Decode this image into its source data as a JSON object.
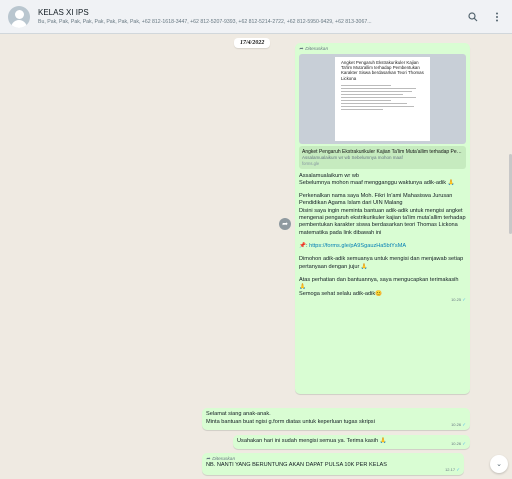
{
  "header": {
    "title": "KELAS XI IPS",
    "subtitle": "Bu, Pak, Pak, Pak, Pak, Pak, Pak, Pak, Pak, +62 812-1618-3447, +62 812-5207-9393, +62 812-5214-2722, +62 812-5950-9429, +62 813-3067..."
  },
  "chat": {
    "date": "17/4/2022",
    "forwarded_label": "Diteruskan",
    "doc": {
      "title": "Angket Pengaruh Ekstrakurikuler Kajian Ta'lim Muta'allim terhadap Pembentukan Karakter Siswa berdasarkan Teori Thomas Lickona"
    },
    "link": {
      "title": "Angket Pengaruh Ekstrakurikuler Kajian Ta'lim Muta'allim terhadap Pembentukan Karakter Siswa...",
      "desc": "Assalamualaikum wr wb Sebelumnya mohon maaf",
      "domain": "forms.gle"
    },
    "main_msg": {
      "p1": "Assalamualaikum wr wb\nSebelumnya mohon maaf mengganggu waktunya adik-adik 🙏",
      "p2": "Perkenalkan nama saya Moh. Fikri In'ami Mahasiswa Jurusan Pendidikan Agama Islam dari UIN Malang\nDisini saya ingin meminta bantuan adik-adik untuk mengisi angket mengenai pengaruh ekstrikurikuler kajian ta'lim muta'allim terhadap pembentukan karakter siswa berdasarkan teori Thomas Lickona matematika pada link dibawah ini",
      "url_prefix": "📌: ",
      "url": "https://forms.gle/pA9SgauzHa5btYsMA",
      "p3": "Dimohon adik-adik semuanya untuk mengisi dan menjawab setiap pertanyaan dengan jujur 🙏",
      "p4": "Atas perhatian dan bantuannya, saya mengucapkan terimakasih 🙏\nSemoga sehat selalu adik-adik😊",
      "time": "10.25"
    },
    "msg2": {
      "line1": "Selamat siang anak-anak.",
      "line2": "Minta bantuan buat ngisi g.form diatas untuk keperluan tugas skripsi",
      "time": "10.26"
    },
    "msg3": {
      "text": "Usahakan hari ini sudah mengisi semua ya. Terima kasih 🙏",
      "time": "10.26"
    },
    "msg4": {
      "text": "NB. NANTI YANG BERUNTUNG AKAN DAPAT PULSA 10K PER KELAS",
      "time": "12.17"
    }
  },
  "icons": {
    "search": "search-icon",
    "menu": "menu-icon",
    "share": "share-icon",
    "scroll": "chevron-down-icon"
  },
  "colors": {
    "outgoing_bubble": "#d9fdd3",
    "chat_bg": "#efeae2",
    "link": "#027eb5",
    "read_tick": "#53bdeb"
  }
}
